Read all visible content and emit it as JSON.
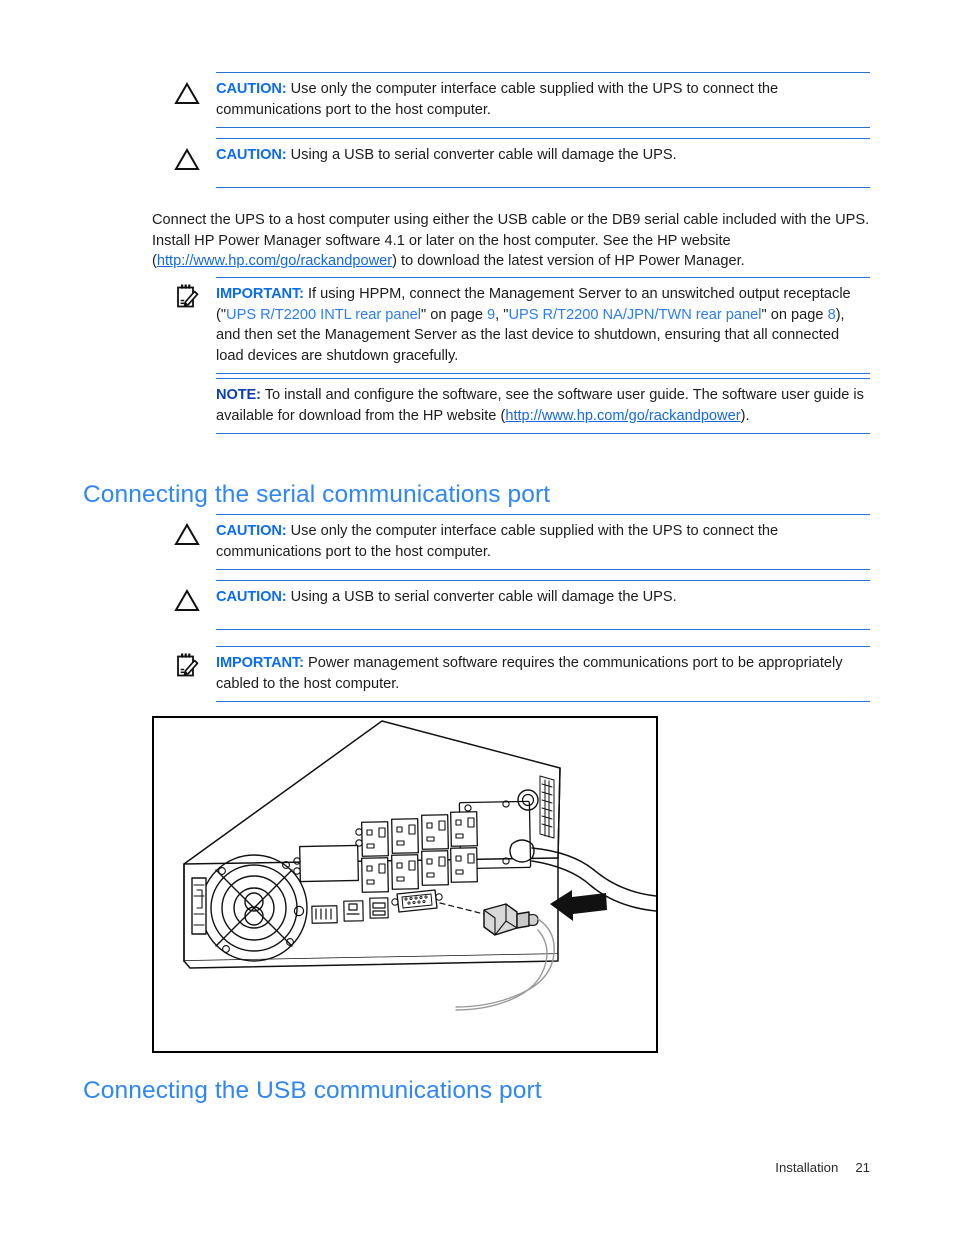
{
  "document": {
    "footer": {
      "chapter": "Installation",
      "page_number": "21"
    }
  },
  "blocks": {
    "caution1": {
      "icon": "caution-triangle-icon",
      "label": "CAUTION:",
      "text": "Use only the computer interface cable supplied with the UPS to connect the communications port to the host computer."
    },
    "caution2": {
      "icon": "caution-triangle-icon",
      "label": "CAUTION:",
      "text": "Using a USB to serial converter cable will damage the UPS."
    },
    "paragraph1": {
      "line1": "Connect the UPS to a host computer using either the USB cable or the DB9 serial cable included with the",
      "line2_before": "UPS. Install HP Power Manager software 4.1 or later on the host computer. See the HP website",
      "line3_open": "(",
      "link_text": "http://www.hp.com/go/rackandpower",
      "line3_after": ") to download the latest version of HP Power Manager."
    },
    "important1": {
      "icon": "important-note-icon",
      "label": "IMPORTANT:",
      "text_part1": "If using HPPM, connect the Management Server to an unswitched output receptacle (\"",
      "xref1": "UPS R/T2200 INTL rear panel",
      "text_part2": "\" on page ",
      "page1": "9",
      "text_part3": ", \"",
      "xref2": "UPS R/T2200 NA/JPN/TWN rear panel",
      "text_part4": "\" on page ",
      "page2": "8",
      "text_part5": "), and then set the Management Server as the last device to shutdown, ensuring that all connected load devices are shutdown gracefully."
    },
    "note1": {
      "label": "NOTE:",
      "text_part1": "To install and configure the software, see the software user guide. The software user guide is available for download from the HP website (",
      "link_text": "http://www.hp.com/go/rackandpower",
      "text_part2": ")."
    },
    "heading_serial": "Connecting the serial communications port",
    "caution3": {
      "icon": "caution-triangle-icon",
      "label": "CAUTION:",
      "text": "Use only the computer interface cable supplied with the UPS to connect the communications port to the host computer."
    },
    "caution4": {
      "icon": "caution-triangle-icon",
      "label": "CAUTION:",
      "text": "Using a USB to serial converter cable will damage the UPS."
    },
    "important2": {
      "icon": "important-note-icon",
      "label": "IMPORTANT:",
      "text": "Power management software requires the communications port to be appropriately cabled to the host computer."
    },
    "figure": {
      "alt": "Line drawing of UPS rear panel with DB9 serial cable being connected to the serial communications port",
      "name": "ups-rear-panel-serial-connection-figure"
    },
    "heading_usb": "Connecting the USB communications port"
  },
  "colors": {
    "heading_blue": "#2f86f7",
    "label_blue": "#0b6cf0",
    "note_blue": "#0b3fb0",
    "rule_blue": "#2574d4",
    "link_blue": "#1668e3",
    "xref_blue": "#2b7df5",
    "body_text": "#1c1c1c",
    "frame_black": "#000000"
  }
}
